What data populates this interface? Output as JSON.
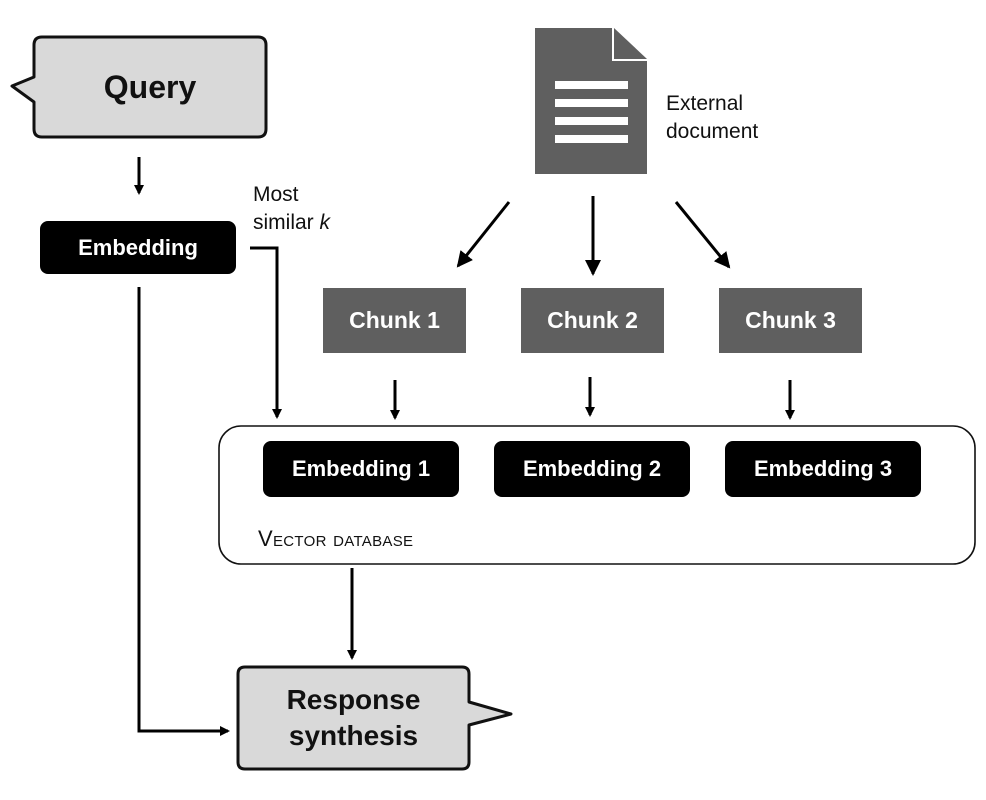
{
  "diagram": {
    "query": {
      "label": "Query"
    },
    "query_embedding": {
      "label": "Embedding"
    },
    "retrieval_note": {
      "line1": "Most",
      "line2_prefix": "similar ",
      "line2_var": "k"
    },
    "external_document": {
      "icon": "document-icon",
      "line1": "External",
      "line2": "document"
    },
    "chunks": [
      {
        "label": "Chunk 1"
      },
      {
        "label": "Chunk 2"
      },
      {
        "label": "Chunk 3"
      }
    ],
    "vector_database": {
      "label": "Vector database",
      "embeddings": [
        {
          "label": "Embedding 1"
        },
        {
          "label": "Embedding 2"
        },
        {
          "label": "Embedding 3"
        }
      ]
    },
    "response": {
      "line1": "Response",
      "line2": "synthesis"
    },
    "colors": {
      "speech_box_fill": "#d9d9d9",
      "embedding_fill": "#000000",
      "chunk_fill": "#5f5f5f",
      "document_fill": "#5f5f5f",
      "stroke": "#111111"
    }
  }
}
